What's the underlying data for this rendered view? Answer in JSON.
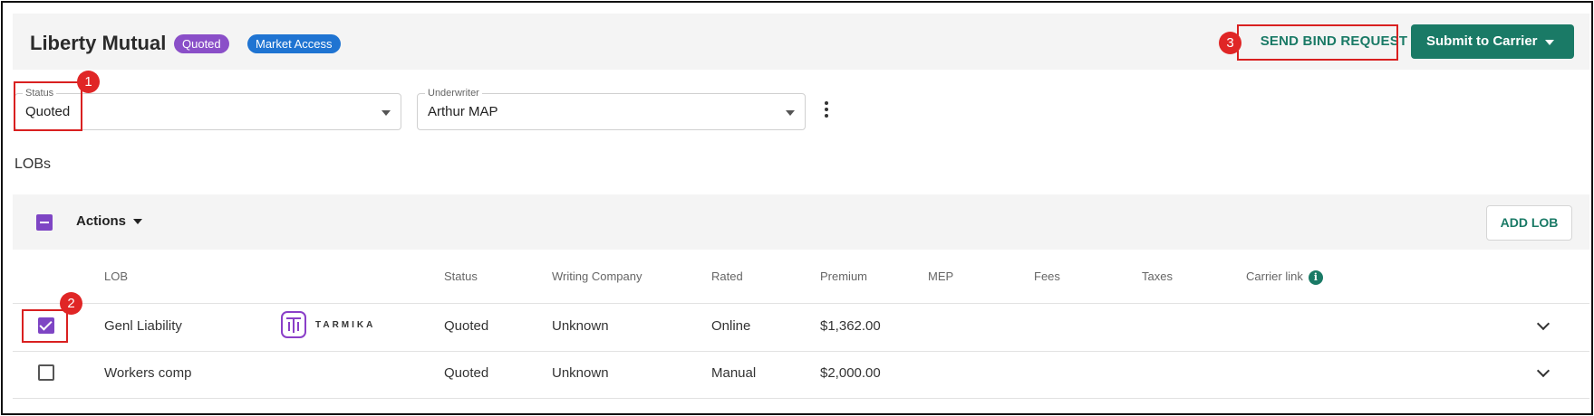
{
  "header": {
    "title": "Liberty Mutual",
    "badges": [
      "Quoted",
      "Market Access"
    ],
    "send_bind_label": "SEND BIND REQUEST",
    "submit_label": "Submit to Carrier"
  },
  "fields": {
    "status": {
      "label": "Status",
      "value": "Quoted"
    },
    "underwriter": {
      "label": "Underwriter",
      "value": "Arthur MAP"
    }
  },
  "lobs_label": "LOBs",
  "actions_bar": {
    "actions_label": "Actions",
    "add_lob_label": "ADD LOB"
  },
  "table": {
    "columns": [
      "LOB",
      "Status",
      "Writing Company",
      "Rated",
      "Premium",
      "MEP",
      "Fees",
      "Taxes",
      "Carrier link"
    ],
    "rows": [
      {
        "lob": "Genl Liability",
        "carrier_logo": "TARMIKA",
        "status": "Quoted",
        "writing_company": "Unknown",
        "rated": "Online",
        "premium": "$1,362.00",
        "checked": true
      },
      {
        "lob": "Workers comp",
        "status": "Quoted",
        "writing_company": "Unknown",
        "rated": "Manual",
        "premium": "$2,000.00",
        "checked": false
      }
    ]
  },
  "annotations": [
    "1",
    "2",
    "3"
  ],
  "colors": {
    "accent_green": "#1a7a66",
    "purple": "#7e45c4",
    "badge_quoted": "#8a4fc8",
    "badge_market": "#1f74d2",
    "annotation_red": "#d92020"
  },
  "icons": [
    "chevron-down-icon",
    "kebab-menu-icon",
    "info-icon",
    "checkbox-checked-icon",
    "checkbox-indeterminate-icon"
  ]
}
